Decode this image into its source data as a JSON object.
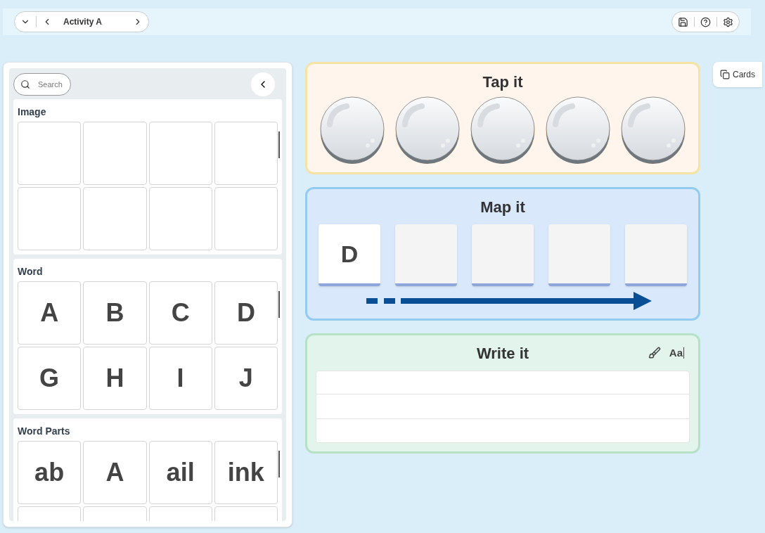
{
  "toolbar": {
    "activity": "Activity A"
  },
  "library": {
    "search": {
      "placeholder": "Search"
    },
    "sections": [
      {
        "title": "Image",
        "tiles": [
          {
            "kind": "blank"
          },
          {
            "kind": "blank"
          },
          {
            "kind": "blank"
          },
          {
            "kind": "blank"
          },
          {
            "kind": "blank"
          },
          {
            "kind": "blank"
          },
          {
            "kind": "blank"
          },
          {
            "kind": "blank"
          }
        ]
      },
      {
        "title": "Word",
        "tiles": [
          {
            "kind": "text",
            "text": "A"
          },
          {
            "kind": "text",
            "text": "B"
          },
          {
            "kind": "text",
            "text": "C"
          },
          {
            "kind": "text",
            "text": "D"
          },
          {
            "kind": "text",
            "text": "G"
          },
          {
            "kind": "text",
            "text": "H"
          },
          {
            "kind": "text",
            "text": "I"
          },
          {
            "kind": "text",
            "text": "J"
          }
        ]
      },
      {
        "title": "Word Parts",
        "tiles": [
          {
            "kind": "text",
            "text": "ab"
          },
          {
            "kind": "text",
            "text": "A"
          },
          {
            "kind": "text",
            "text": "ail"
          },
          {
            "kind": "text",
            "text": "ink"
          },
          {
            "kind": "blank"
          },
          {
            "kind": "blank"
          },
          {
            "kind": "blank"
          },
          {
            "kind": "blank"
          }
        ]
      }
    ]
  },
  "activities": [
    {
      "kind": "tap",
      "title": "Tap it",
      "tokens": [
        {
          "kind": "token"
        },
        {
          "kind": "token"
        },
        {
          "kind": "token"
        },
        {
          "kind": "token"
        },
        {
          "kind": "token"
        }
      ]
    },
    {
      "kind": "map",
      "title": "Map it",
      "boxes": [
        {
          "kind": "letter",
          "text": "D"
        },
        {
          "kind": "blank"
        },
        {
          "kind": "blank"
        },
        {
          "kind": "blank"
        },
        {
          "kind": "blank"
        }
      ]
    },
    {
      "kind": "write",
      "title": "Write it",
      "font_button": "Aa"
    }
  ],
  "cards_button": "Cards"
}
